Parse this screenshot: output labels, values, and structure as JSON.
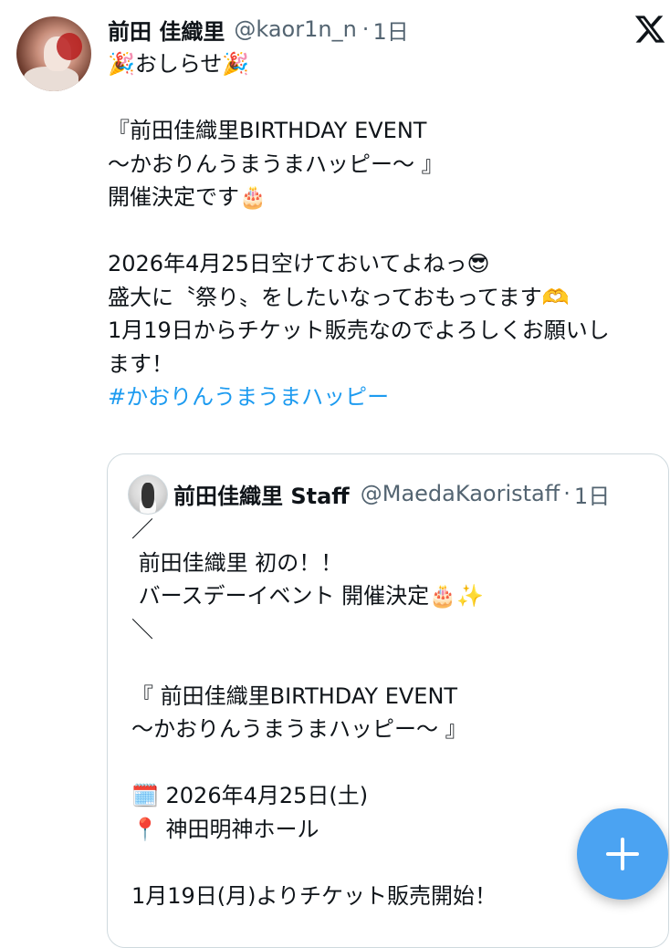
{
  "tweet": {
    "author_name": "前田 佳織里",
    "handle": "@kaor1n_n",
    "separator": "·",
    "time": "1日",
    "text": "🎉おしらせ🎉\n\n『前田佳織里BIRTHDAY EVENT\n〜かおりんうまうまハッピー〜 』\n開催決定です🎂\n\n2026年4月25日空けておいてよねっ😎\n盛大に〝祭り〟をしたいなっておもってます🫶\n1月19日からチケット販売なのでよろしくお願いし\nます！\n",
    "hashtag": "#かおりんうまうまハッピー"
  },
  "quoted_tweet": {
    "author_name": "前田佳織里 Staff",
    "handle": "@MaedaKaoristaff",
    "separator": "·",
    "time": "1日",
    "text": "／\n 前田佳織里 初の！！\n バースデーイベント 開催決定🎂✨\n＼\n\n『 前田佳織里BIRTHDAY EVENT\n〜かおりんうまうまハッピー〜 』\n\n🗓️ 2026年4月25日(土)\n📍 神田明神ホール\n\n1月19日(月)よりチケット販売開始！"
  },
  "icons": {
    "logo": "x-logo-icon",
    "compose": "plus-icon"
  },
  "colors": {
    "hashtag": "#1d9bf0",
    "fab": "#4ba3f2",
    "secondary_text": "#536471"
  }
}
